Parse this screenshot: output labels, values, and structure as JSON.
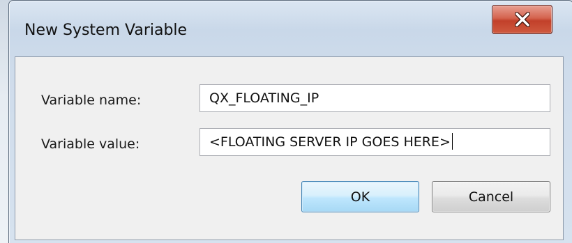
{
  "dialog": {
    "title": "New System Variable",
    "close_icon": "close-x-icon"
  },
  "form": {
    "name_label": "Variable name:",
    "name_value": "QX_FLOATING_IP",
    "value_label": "Variable value:",
    "value_value": "<FLOATING SERVER IP GOES HERE>"
  },
  "buttons": {
    "ok_label": "OK",
    "cancel_label": "Cancel"
  },
  "colors": {
    "close_button": "#c94a35",
    "ok_button_border": "#3c7fb1",
    "titlebar": "#cfdceb"
  }
}
